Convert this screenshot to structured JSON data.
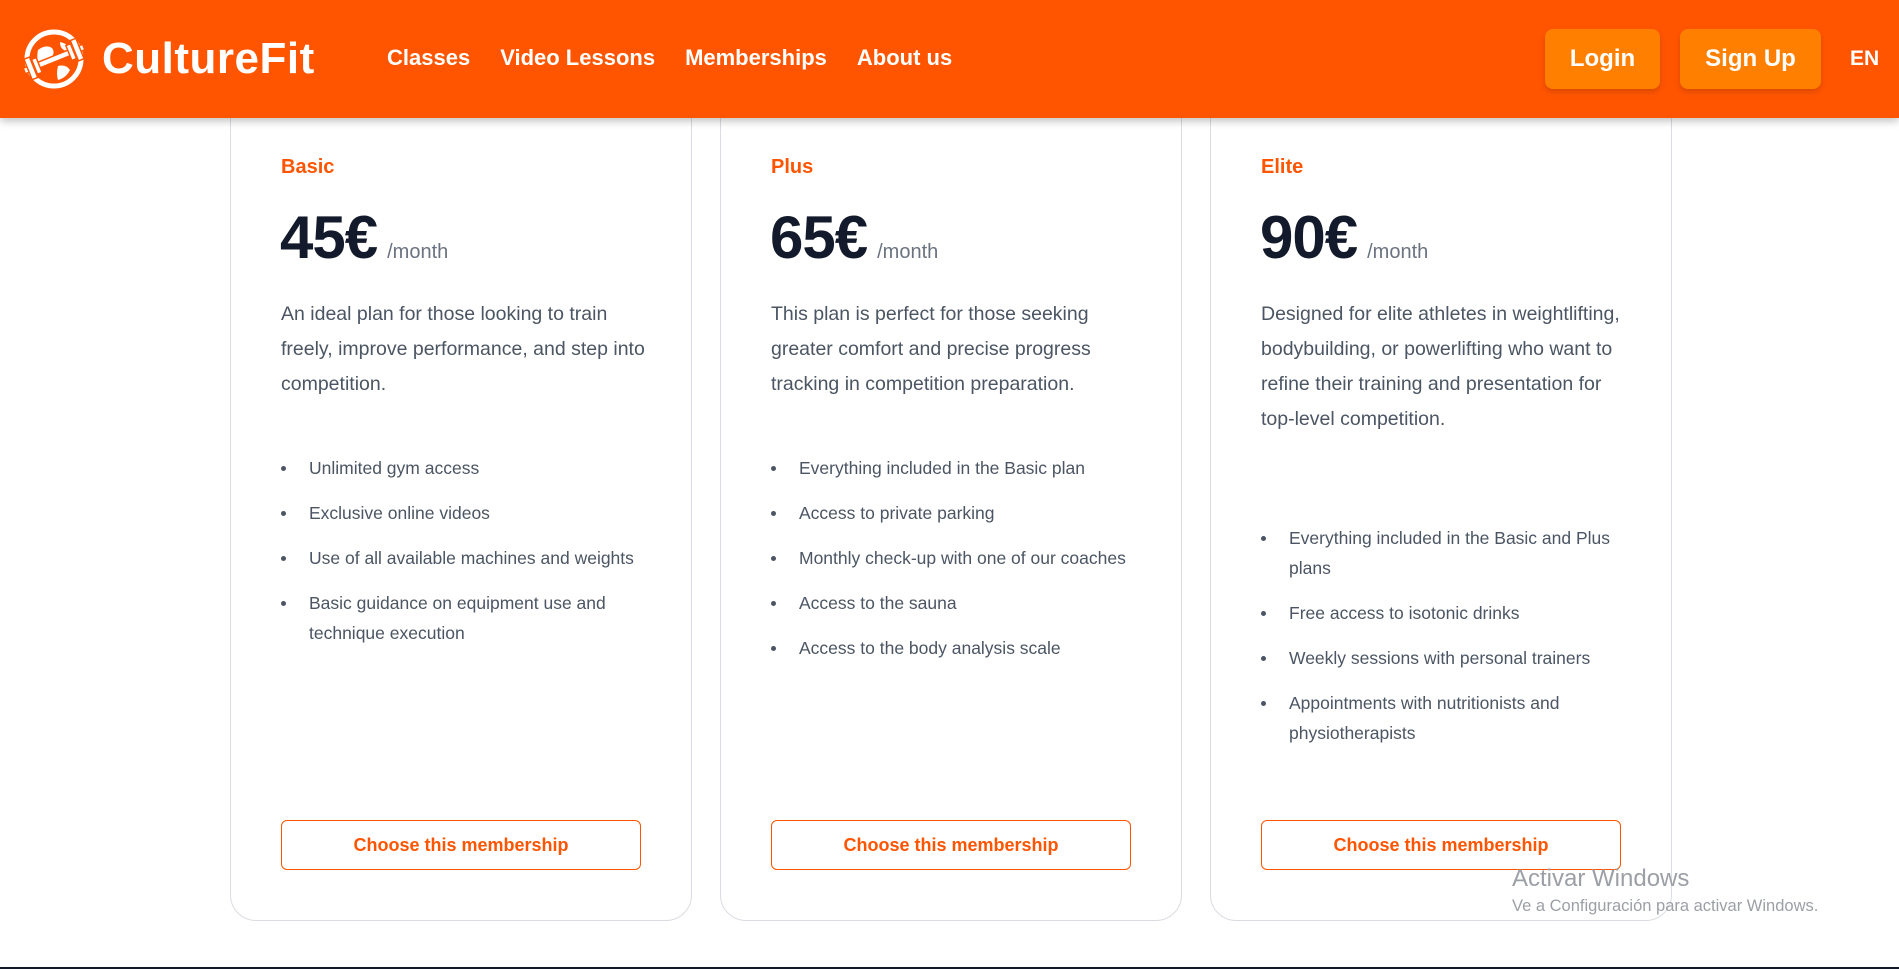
{
  "colors": {
    "brand": "#ff5500",
    "button_accent": "#ff8000",
    "heading": "#131a2b",
    "body_text": "#4b5563"
  },
  "navbar": {
    "brand_name": "CultureFit",
    "logo_icon": "globe-barbell-icon",
    "links": [
      "Classes",
      "Video Lessons",
      "Memberships",
      "About us"
    ],
    "login_label": "Login",
    "signup_label": "Sign Up",
    "language": "EN"
  },
  "plans": [
    {
      "name": "Basic",
      "price": "45€",
      "period": "/month",
      "description": "An ideal plan for those looking to train freely, improve performance, and step into competition.",
      "features": [
        "Unlimited gym access",
        "Exclusive online videos",
        "Use of all available machines and weights",
        "Basic guidance on equipment use and technique execution"
      ],
      "button_label": "Choose this membership"
    },
    {
      "name": "Plus",
      "price": "65€",
      "period": "/month",
      "description": "This plan is perfect for those seeking greater comfort and precise progress tracking in competition preparation.",
      "features": [
        "Everything included in the Basic plan",
        "Access to private parking",
        "Monthly check-up with one of our coaches",
        "Access to the sauna",
        "Access to the body analysis scale"
      ],
      "button_label": "Choose this membership"
    },
    {
      "name": "Elite",
      "price": "90€",
      "period": "/month",
      "description": "Designed for elite athletes in weightlifting, bodybuilding, or powerlifting who want to refine their training and presentation for top-level competition.",
      "features": [
        "Everything included in the Basic and Plus plans",
        "Free access to isotonic drinks",
        "Weekly sessions with personal trainers",
        "Appointments with nutritionists and physiotherapists"
      ],
      "button_label": "Choose this membership"
    }
  ],
  "watermark": {
    "title": "Activar Windows",
    "subtitle": "Ve a Configuración para activar Windows."
  }
}
